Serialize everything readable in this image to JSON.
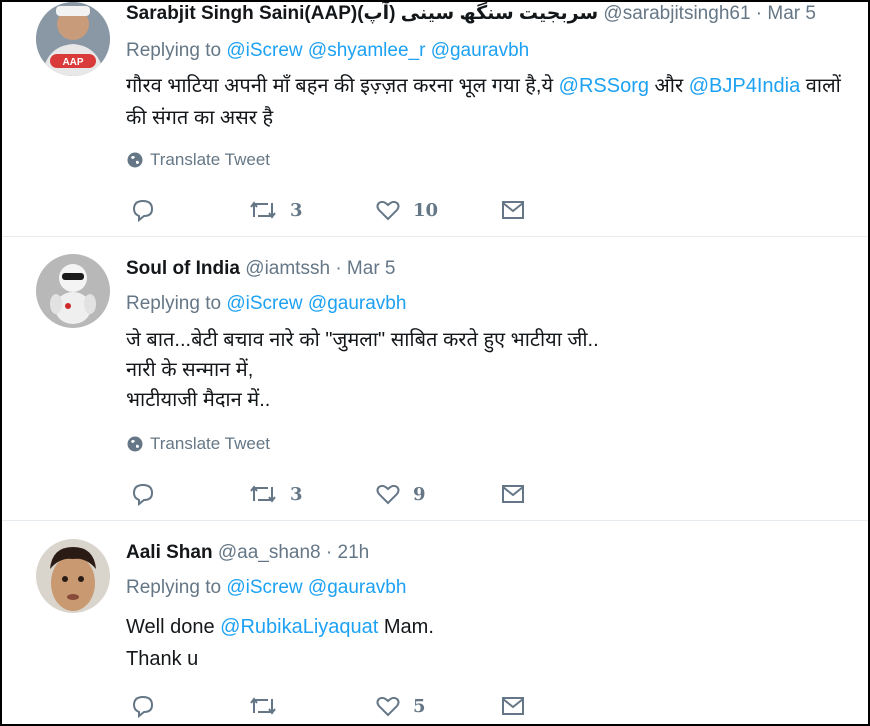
{
  "tweets": [
    {
      "name": "Sarabjit Singh Saini(AAP)(سربجیت سنگھ سینی (آپ",
      "handle": "@sarabjitsingh61",
      "time": "· Mar 5",
      "replying_label": "Replying to",
      "reply_to": [
        "@iScrew",
        "@shyamlee_r",
        "@gauravbh"
      ],
      "body_parts": [
        {
          "t": "गौरव भाटिया अपनी माँ बहन की इज़्ज़त करना भूल गया है,ये ",
          "link": false
        },
        {
          "t": "@RSSorg",
          "link": true
        },
        {
          "t": " और ",
          "link": false
        },
        {
          "t": "@BJP4India",
          "link": true
        },
        {
          "t": " वालों की संगत का असर है",
          "link": false
        }
      ],
      "translate": "Translate Tweet",
      "retweets": "3",
      "likes": "10",
      "avatar_badge": "AAP"
    },
    {
      "name": "Soul of India",
      "handle": "@iamtssh",
      "time": "· Mar 5",
      "replying_label": "Replying to",
      "reply_to": [
        "@iScrew",
        "@gauravbh"
      ],
      "body_lines": [
        "जे बात...बेटी बचाव नारे को \"जुमला\" साबित करते हुए भाटीया जी..",
        "नारी के सन्मान में,",
        "भाटीयाजी मैदान में.."
      ],
      "translate": "Translate Tweet",
      "retweets": "3",
      "likes": "9"
    },
    {
      "name": "Aali Shan",
      "handle": "@aa_shan8",
      "time": "· 21h",
      "replying_label": "Replying to",
      "reply_to": [
        "@iScrew",
        "@gauravbh"
      ],
      "body_line1_parts": [
        {
          "t": "Well done ",
          "link": false
        },
        {
          "t": "@RubikaLiyaquat",
          "link": true
        },
        {
          "t": " Mam.",
          "link": false
        }
      ],
      "body_line2": "Thank u",
      "retweets": "",
      "likes": "5"
    }
  ],
  "colors": {
    "link": "#1da1f2",
    "muted": "#657786",
    "text": "#14171a",
    "divider": "#e6ecf0"
  },
  "icons": {
    "reply": "reply-icon",
    "retweet": "retweet-icon",
    "like": "heart-icon",
    "dm": "envelope-icon",
    "globe": "globe-icon"
  }
}
